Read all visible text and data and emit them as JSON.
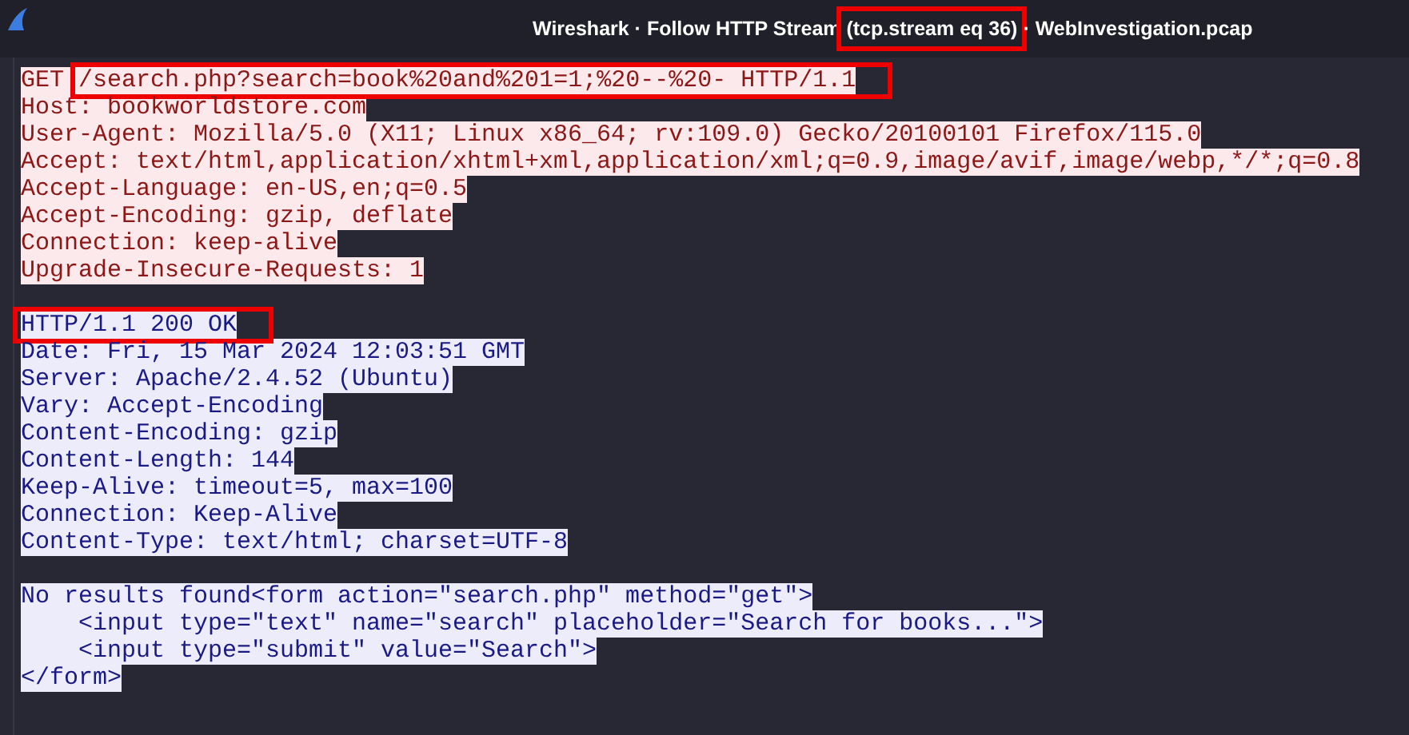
{
  "window": {
    "title": [
      {
        "text": "Wireshark · Follow HTTP Stream ",
        "highlighted": false
      },
      {
        "text": "(tcp.stream eq 36)",
        "highlighted": true
      },
      {
        "text": " · WebInvestigation.pcap",
        "highlighted": false
      }
    ]
  },
  "stream": [
    {
      "kind": "client",
      "blocks": [
        [
          {
            "parts": [
              {
                "text": "GET ",
                "highlighted": false
              },
              {
                "text": "/search.php?search=book%20and%201=1;%20--%20- HTTP/1.1",
                "highlighted": true
              }
            ]
          },
          {
            "parts": [
              {
                "text": "Host: bookworldstore.com",
                "highlighted": false
              }
            ]
          },
          {
            "parts": [
              {
                "text": "User-Agent: Mozilla/5.0 (X11; Linux x86_64; rv:109.0) Gecko/20100101 Firefox/115.0",
                "highlighted": false
              }
            ]
          },
          {
            "parts": [
              {
                "text": "Accept: text/html,application/xhtml+xml,application/xml;q=0.9,image/avif,image/webp,*/*;q=0.8",
                "highlighted": false
              }
            ]
          },
          {
            "parts": [
              {
                "text": "Accept-Language: en-US,en;q=0.5",
                "highlighted": false
              }
            ]
          },
          {
            "parts": [
              {
                "text": "Accept-Encoding: gzip, deflate",
                "highlighted": false
              }
            ]
          },
          {
            "parts": [
              {
                "text": "Connection: keep-alive",
                "highlighted": false
              }
            ]
          },
          {
            "parts": [
              {
                "text": "Upgrade-Insecure-Requests: 1",
                "highlighted": false
              }
            ]
          }
        ]
      ]
    },
    {
      "kind": "server",
      "blocks": [
        [
          {
            "parts": [
              {
                "text": "HTTP/1.1 200 OK",
                "highlighted": true
              }
            ]
          },
          {
            "parts": [
              {
                "text": "Date: Fri, 15 Mar 2024 12:03:51 GMT",
                "highlighted": false
              }
            ]
          },
          {
            "parts": [
              {
                "text": "Server: Apache/2.4.52 (Ubuntu)",
                "highlighted": false
              }
            ]
          },
          {
            "parts": [
              {
                "text": "Vary: Accept-Encoding",
                "highlighted": false
              }
            ]
          },
          {
            "parts": [
              {
                "text": "Content-Encoding: gzip",
                "highlighted": false
              }
            ]
          },
          {
            "parts": [
              {
                "text": "Content-Length: 144",
                "highlighted": false
              }
            ]
          },
          {
            "parts": [
              {
                "text": "Keep-Alive: timeout=5, max=100",
                "highlighted": false
              }
            ]
          },
          {
            "parts": [
              {
                "text": "Connection: Keep-Alive",
                "highlighted": false
              }
            ]
          },
          {
            "parts": [
              {
                "text": "Content-Type: text/html; charset=UTF-8",
                "highlighted": false
              }
            ]
          }
        ],
        [
          {
            "parts": [
              {
                "text": "No results found<form action=\"search.php\" method=\"get\">",
                "highlighted": false
              }
            ]
          },
          {
            "parts": [
              {
                "text": "    <input type=\"text\" name=\"search\" placeholder=\"Search for books...\">",
                "highlighted": false
              }
            ]
          },
          {
            "parts": [
              {
                "text": "    <input type=\"submit\" value=\"Search\">",
                "highlighted": false
              }
            ]
          },
          {
            "parts": [
              {
                "text": "</form>",
                "highlighted": false
              }
            ]
          }
        ]
      ]
    }
  ]
}
